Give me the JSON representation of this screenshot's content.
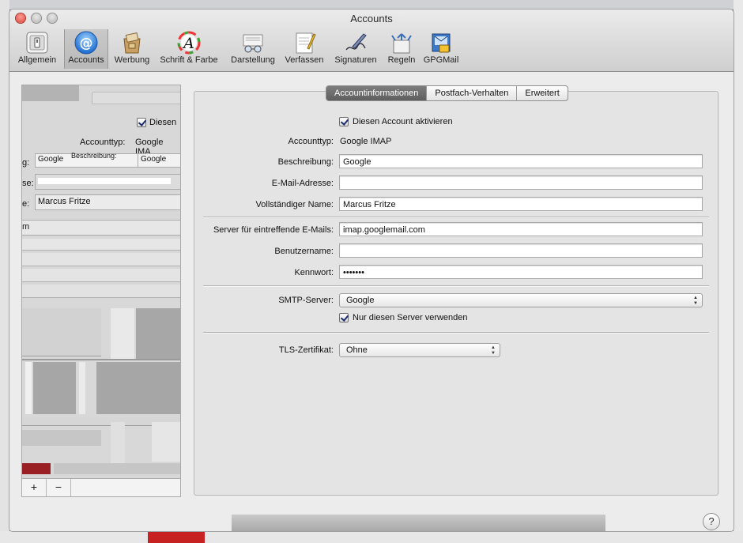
{
  "window": {
    "title": "Accounts"
  },
  "toolbar": {
    "items": [
      {
        "label": "Allgemein",
        "icon": "switch-icon"
      },
      {
        "label": "Accounts",
        "icon": "at-sign-icon"
      },
      {
        "label": "Werbung",
        "icon": "junk-mail-icon"
      },
      {
        "label": "Schrift & Farbe",
        "icon": "font-icon"
      },
      {
        "label": "Darstellung",
        "icon": "glasses-icon"
      },
      {
        "label": "Verfassen",
        "icon": "compose-icon"
      },
      {
        "label": "Signaturen",
        "icon": "signature-pen-icon"
      },
      {
        "label": "Regeln",
        "icon": "rules-icon"
      },
      {
        "label": "GPGMail",
        "icon": "gpgmail-icon"
      }
    ],
    "active": "Accounts"
  },
  "sidebar_ghost": {
    "checkbox_label": "Diesen",
    "accounttyp_label": "Accounttyp:",
    "accounttyp_value": "Google IMA",
    "row1_label": "g:",
    "row1_value": "Google",
    "row1_overlay": "Beschreibung:",
    "row1_overlay_value": "Google",
    "row2_label": "se:",
    "row3_label": "e:",
    "row3_value": "Marcus Fritze",
    "row4_value": "m"
  },
  "sidebar_footer": {
    "add_label": "+",
    "remove_label": "−"
  },
  "tabs": [
    {
      "label": "Accountinformationen",
      "selected": true
    },
    {
      "label": "Postfach-Verhalten",
      "selected": false
    },
    {
      "label": "Erweitert",
      "selected": false
    }
  ],
  "form": {
    "enable_account_label": "Diesen Account aktivieren",
    "enable_account_checked": true,
    "accounttyp_label": "Accounttyp:",
    "accounttyp_value": "Google IMAP",
    "beschreibung_label": "Beschreibung:",
    "beschreibung_value": "Google",
    "email_label": "E-Mail-Adresse:",
    "email_value": "",
    "name_label": "Vollständiger Name:",
    "name_value": "Marcus Fritze",
    "server_label": "Server für eintreffende E-Mails:",
    "server_value": "imap.googlemail.com",
    "username_label": "Benutzername:",
    "username_value": "",
    "password_label": "Kennwort:",
    "password_value": "•••••••",
    "smtp_label": "SMTP-Server:",
    "smtp_value": "Google",
    "only_server_label": "Nur diesen Server verwenden",
    "only_server_checked": true,
    "tls_label": "TLS-Zertifikat:",
    "tls_value": "Ohne"
  },
  "help": {
    "label": "?"
  },
  "colors": {
    "accent": "#1c2d6b",
    "selected_tab": "#6a6a6a",
    "close_button": "#d6463b"
  }
}
